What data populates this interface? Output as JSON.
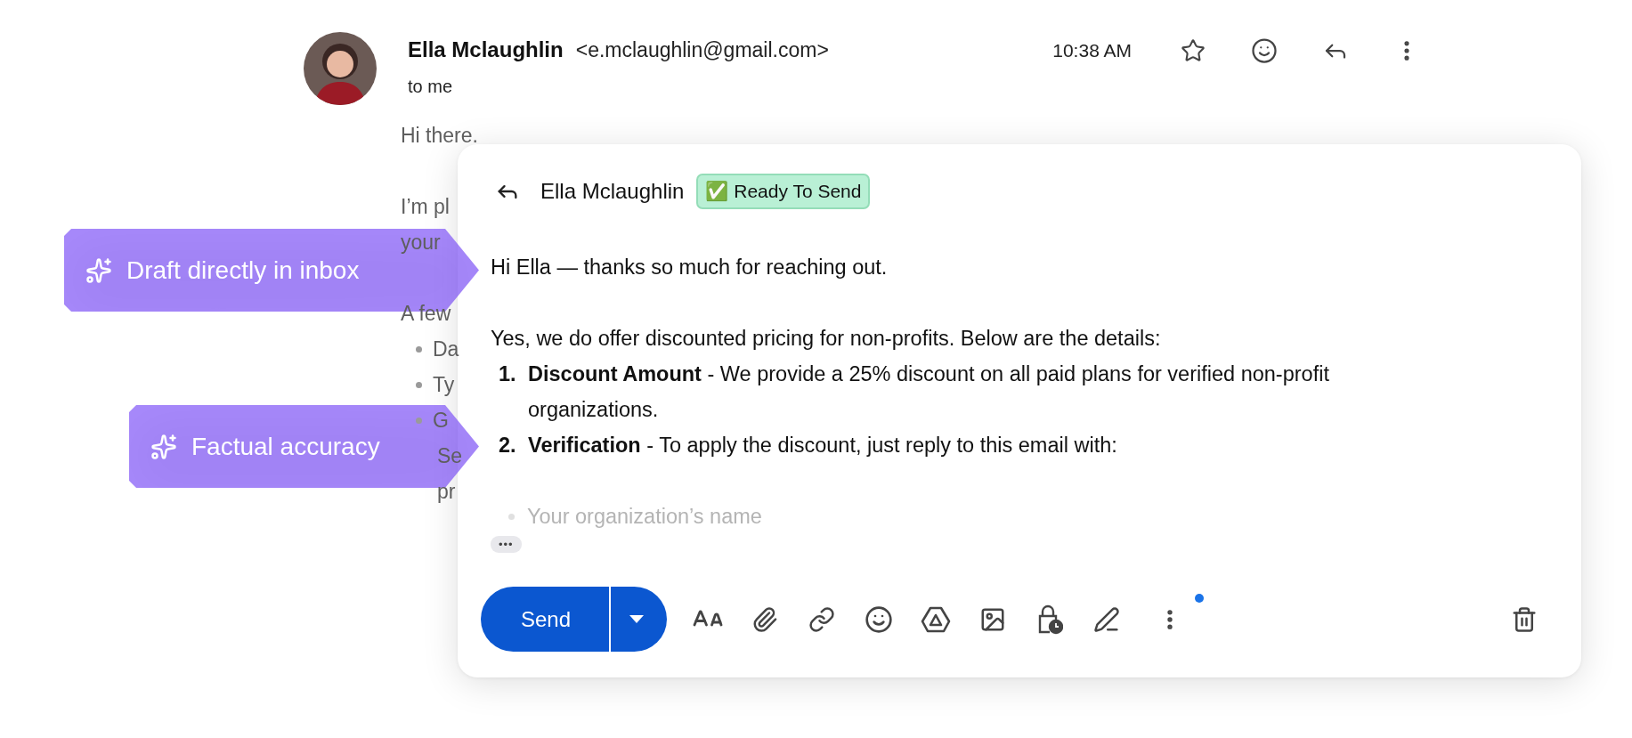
{
  "email": {
    "sender_name": "Ella Mclaughlin",
    "sender_email": "<e.mclaughlin@gmail.com>",
    "recipient": "to me",
    "time": "10:38 AM",
    "body": [
      {
        "kind": "line",
        "text": "Hi there."
      },
      {
        "kind": "gap"
      },
      {
        "kind": "line",
        "text": "I’m pl"
      },
      {
        "kind": "line",
        "text": "your"
      },
      {
        "kind": "gap"
      },
      {
        "kind": "line",
        "text": "A few"
      },
      {
        "kind": "bullet",
        "text": "Da"
      },
      {
        "kind": "bullet",
        "text": "Ty"
      },
      {
        "kind": "bullet",
        "text": "G"
      },
      {
        "kind": "indent",
        "text": "Se"
      },
      {
        "kind": "indent",
        "text": "pr"
      }
    ]
  },
  "compose": {
    "recipient": "Ella Mclaughlin",
    "status_badge": "✅ Ready To Send",
    "body": [
      {
        "kind": "paragraph",
        "text": "Hi Ella — thanks so much for reaching out."
      },
      {
        "kind": "gap"
      },
      {
        "kind": "paragraph",
        "text": "Yes, we do offer discounted pricing for non-profits. Below are the details:"
      },
      {
        "kind": "numbered",
        "number": "1.",
        "text": "**Discount Amount** - We provide a 25% discount on all paid plans for verified non-profit organizations."
      },
      {
        "kind": "numbered",
        "number": "2.",
        "text": "**Verification** - To apply the discount, just reply to this email with:"
      },
      {
        "kind": "gap"
      },
      {
        "kind": "faded_bullet",
        "text": "Your organization’s name"
      }
    ],
    "more_label": "•••",
    "send_label": "Send",
    "more_options_dot": true
  },
  "callouts": [
    {
      "text": "Draft directly in inbox"
    },
    {
      "text": "Factual accuracy"
    }
  ]
}
